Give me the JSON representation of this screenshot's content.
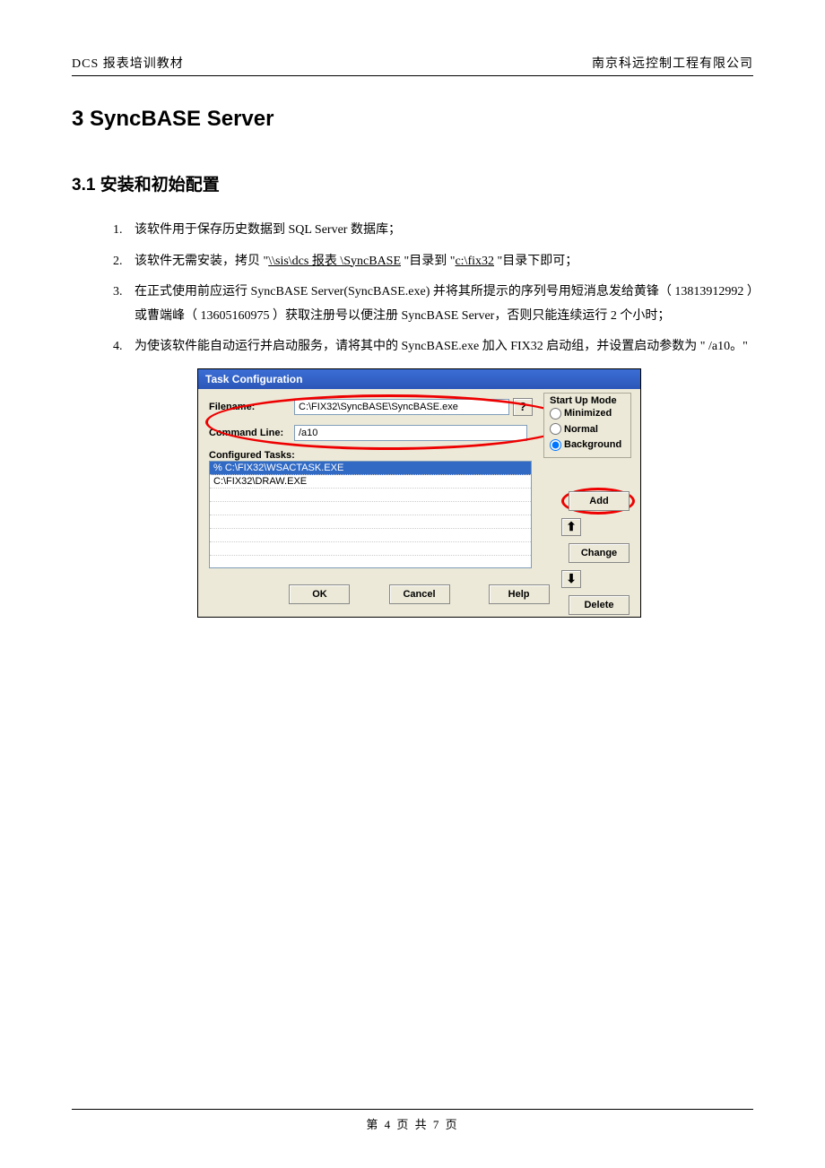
{
  "header": {
    "left": "DCS  报表培训教材",
    "right": "南京科远控制工程有限公司"
  },
  "section_title": "3 SyncBASE Server",
  "subsection_title": "3.1 安装和初始配置",
  "list": {
    "item1": "该软件用于保存历史数据到     SQL Server 数据库；",
    "item2_a": "该软件无需安装，拷贝   \"",
    "item2_link1": "\\\\sis\\dcs 报表 \\SyncBASE",
    "item2_b": "  \"目录到  \"",
    "item2_link2": "c:\\fix32",
    "item2_c": "  \"目录下即可；",
    "item3": "在正式使用前应运行    SyncBASE   Server(SyncBASE.exe) 并将其所提示的序列号用短消息发给黄锋（ 13813912992 ）或曹端峰（  13605160975 ）获取注册号以便注册     SyncBASE  Server，否则只能连续运行  2 个小时；",
    "item4": "为使该软件能自动运行并启动服务，请将其中的        SyncBASE.exe 加入 FIX32  启动组，并设置启动参数为  \" /a10。\""
  },
  "dialog": {
    "title": "Task Configuration",
    "filename_label": "Filename:",
    "filename_value": "C:\\FIX32\\SyncBASE\\SyncBASE.exe",
    "browse": "?",
    "cmdline_label": "Command Line:",
    "cmdline_value": "/a10",
    "mode_legend": "Start Up Mode",
    "mode_min": "Minimized",
    "mode_norm": "Normal",
    "mode_bg": "Background",
    "configured_label": "Configured Tasks:",
    "task0": "% C:\\FIX32\\WSACTASK.EXE",
    "task1": "C:\\FIX32\\DRAW.EXE",
    "btn_add": "Add",
    "btn_change": "Change",
    "btn_delete": "Delete",
    "btn_up": "⬆",
    "btn_down": "⬇",
    "btn_ok": "OK",
    "btn_cancel": "Cancel",
    "btn_help": "Help"
  },
  "footer": "第  4 页 共  7 页"
}
